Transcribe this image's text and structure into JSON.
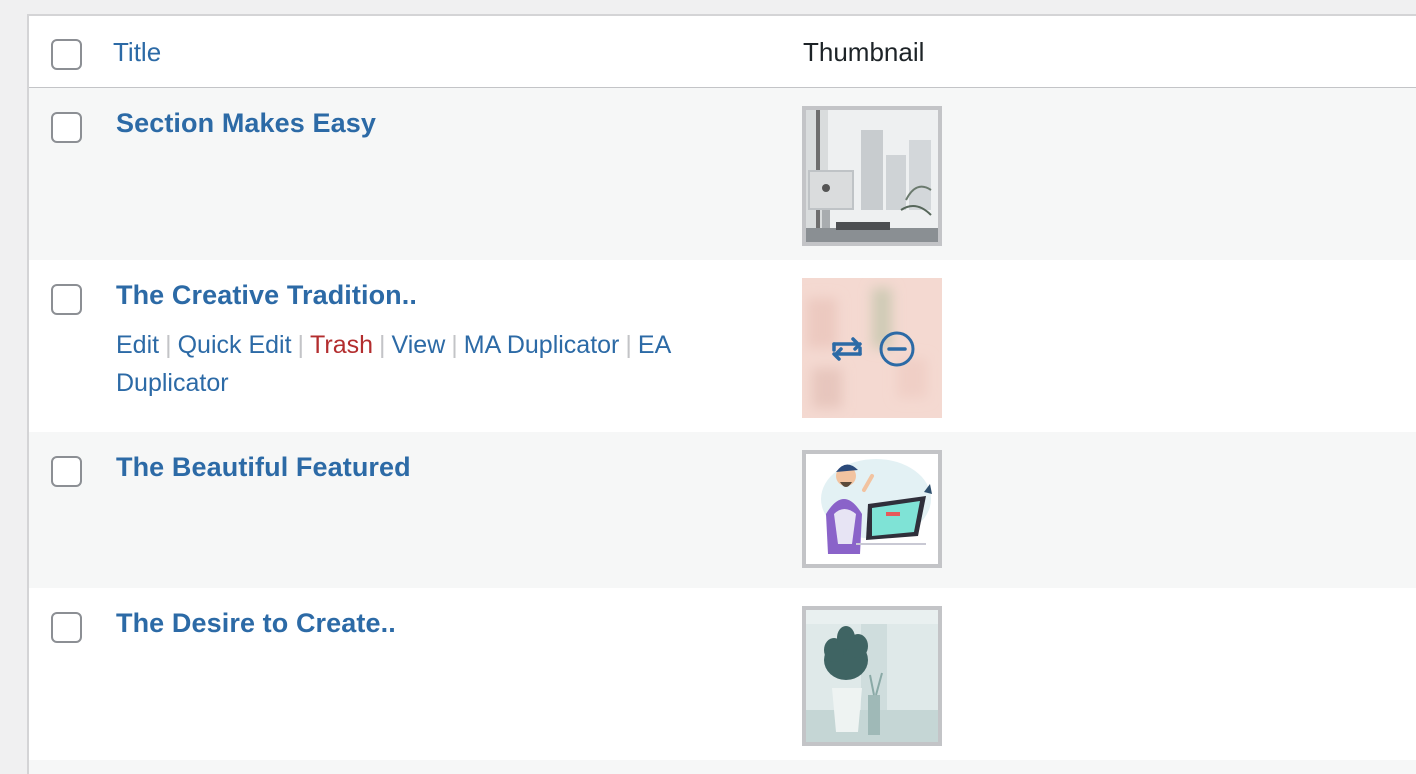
{
  "table": {
    "header": {
      "title_label": "Title",
      "thumbnail_label": "Thumbnail"
    },
    "rows": [
      {
        "title": "Section Makes Easy",
        "thumbnail": "office-desk-photo"
      },
      {
        "title": "The Creative Tradition..",
        "thumbnail": "blurred-pink-photo",
        "actions": {
          "edit": "Edit",
          "quick_edit": "Quick Edit",
          "trash": "Trash",
          "view": "View",
          "ma_duplicator": "MA Duplicator",
          "ea_duplicator": "EA Duplicator",
          "separator": "|"
        },
        "thumb_icons": [
          "swap-icon",
          "remove-icon"
        ]
      },
      {
        "title": "The Beautiful Featured",
        "thumbnail": "man-at-computer-illustration"
      },
      {
        "title": "The Desire to Create..",
        "thumbnail": "potted-plant-photo"
      }
    ]
  },
  "colors": {
    "link": "#2c6aa6",
    "trash": "#b32d2e",
    "alt_row": "#f6f7f7",
    "border": "#c3c4c7"
  }
}
